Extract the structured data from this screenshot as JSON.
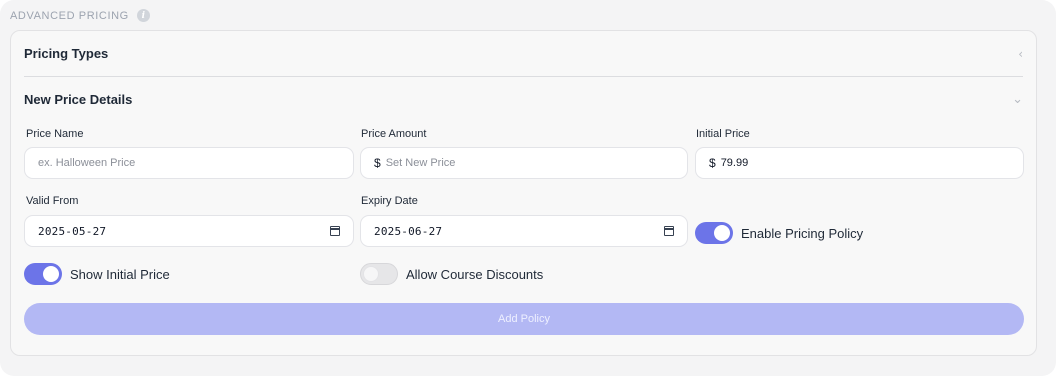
{
  "section": {
    "title": "ADVANCED PRICING",
    "info_glyph": "i"
  },
  "pricing_types": {
    "label": "Pricing Types",
    "chevron": "‹"
  },
  "new_price": {
    "label": "New Price Details",
    "chevron": "⌄"
  },
  "fields": {
    "price_name": {
      "label": "Price Name",
      "placeholder": "ex. Halloween Price",
      "value": ""
    },
    "price_amount": {
      "label": "Price Amount",
      "prefix": "$",
      "placeholder": "Set New Price",
      "value": ""
    },
    "initial_price": {
      "label": "Initial Price",
      "prefix": "$",
      "value": "79.99"
    },
    "valid_from": {
      "label": "Valid From",
      "value": "2025-05-27"
    },
    "expiry_date": {
      "label": "Expiry Date",
      "value": "2025-06-27"
    }
  },
  "toggles": {
    "enable_pricing_policy": {
      "label": "Enable Pricing Policy",
      "on": true
    },
    "show_initial_price": {
      "label": "Show Initial Price",
      "on": true
    },
    "allow_course_discounts": {
      "label": "Allow Course Discounts",
      "on": false
    }
  },
  "add_policy": {
    "label": "Add Policy",
    "disabled": true
  },
  "colors": {
    "accent": "#6c74e8",
    "button_disabled": "#b3b8f4"
  },
  "icons": {
    "info": "info-icon",
    "calendar": "calendar-icon",
    "chevron_left": "chevron-left-icon",
    "chevron_down": "chevron-down-icon"
  }
}
